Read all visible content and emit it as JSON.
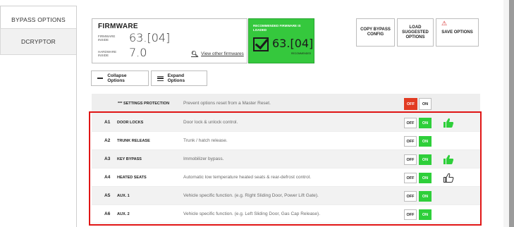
{
  "tabs": [
    {
      "label": "BYPASS OPTIONS"
    },
    {
      "label": "DCRYPTOR"
    }
  ],
  "firmware": {
    "title": "FIRMWARE",
    "firmware_inside_label": "FIRMWARE INSIDE",
    "firmware_inside_value": "63.[04]",
    "hardware_inside_label": "HARDWARE INSIDE",
    "hardware_inside_value": "7.0",
    "view_link": "View other firmwares"
  },
  "recommended": {
    "title": "RECOMMENDED FIRMWARE IS LOADED",
    "value": "63.[04]",
    "sub": "RECOMMENDED"
  },
  "toolbar": {
    "copy_label": "COPY BYPASS CONFIG",
    "load_label": "LOAD SUGGESTED OPTIONS",
    "save_label": "SAVE OPTIONS"
  },
  "controls": {
    "collapse_label": "Collapse Options",
    "expand_label": "Expand Options"
  },
  "settings_protection": {
    "name": "*** SETTINGS PROTECTION",
    "desc": "Prevent options reset from a Master Reset.",
    "off": "OFF",
    "on": "ON"
  },
  "options": [
    {
      "code": "A1",
      "name": "DOOR LOCKS",
      "desc": "Door lock & unlock control.",
      "off": "OFF",
      "on": "ON",
      "thumb": "thumbs-up-green"
    },
    {
      "code": "A2",
      "name": "TRUNK RELEASE",
      "desc": "Trunk / hatch release.",
      "off": "OFF",
      "on": "ON",
      "thumb": ""
    },
    {
      "code": "A3",
      "name": "KEY BYPASS",
      "desc": "Immobilizer bypass.",
      "off": "OFF",
      "on": "ON",
      "thumb": "thumbs-up-green"
    },
    {
      "code": "A4",
      "name": "HEATED SEATS",
      "desc": "Automatic low temperature heated seats & rear-defrost control.",
      "off": "OFF",
      "on": "ON",
      "thumb": "thumbs-up-outline"
    },
    {
      "code": "A5",
      "name": "AUX. 1",
      "desc": "Vehicle specific function. (e.g. Right Sliding Door, Power Lift Gate).",
      "off": "OFF",
      "on": "ON",
      "thumb": ""
    },
    {
      "code": "A6",
      "name": "AUX. 2",
      "desc": "Vehicle specific function. (e.g. Left Sliding Door, Gas Cap Release).",
      "off": "OFF",
      "on": "ON",
      "thumb": ""
    }
  ],
  "colors": {
    "accent_green": "#2ecf3a",
    "off_red": "#e23b22",
    "highlight_red": "#e01515"
  }
}
